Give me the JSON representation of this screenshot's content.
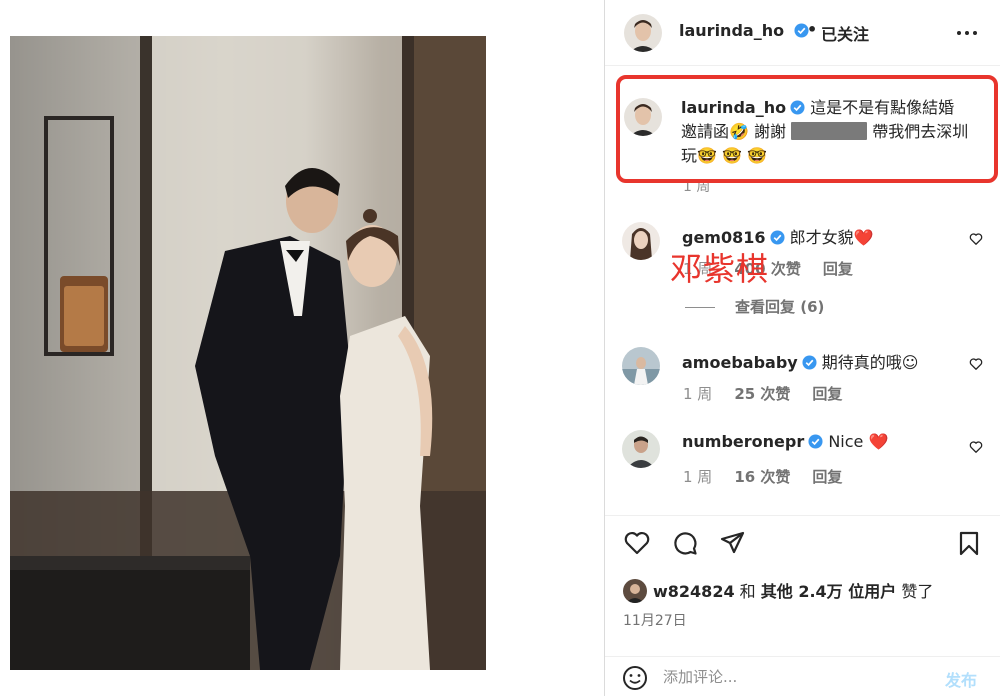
{
  "post": {
    "author": "laurinda_ho",
    "follow_status": "已关注",
    "dot": "•"
  },
  "caption": {
    "username": "laurinda_ho",
    "line1": " 這是不是有點像結婚",
    "line2": "邀請函🤣 謝謝 ",
    "line2b": " 帶我們去深圳",
    "line3": "玩🤓 🤓 🤓",
    "time": "1 周"
  },
  "comments": [
    {
      "username": "gem0816",
      "text": " 郎才女貌❤️",
      "time": "1 周",
      "likes": "400 次赞",
      "reply": "回复",
      "verified": true
    },
    {
      "username": "amoebababy",
      "text": " 期待真的哦☺",
      "time": "1 周",
      "likes": "25 次赞",
      "reply": "回复",
      "verified": true
    },
    {
      "username": "numberonepr",
      "text": " Nice ❤️",
      "time": "1 周",
      "likes": "16 次赞",
      "reply": "回复",
      "verified": true
    }
  ],
  "view_replies": "查看回复 (6)",
  "overlay_annotation": "邓紫棋",
  "likes_summary": {
    "user": "w824824",
    "and": " 和 ",
    "others": "其他 2.4万 位用户",
    "suffix": " 赞了"
  },
  "date": "11月27日",
  "composer": {
    "placeholder": "添加评论...",
    "post_label": "发布"
  },
  "icons": {
    "verified": "verified-badge-icon",
    "more": "more-options-icon",
    "like": "heart-icon",
    "comment": "comment-icon",
    "share": "share-icon",
    "save": "bookmark-icon",
    "emoji": "emoji-icon"
  },
  "colors": {
    "verified": "#3897f0",
    "annotation_red": "#e8352d",
    "post_disabled": "#b2dffc"
  }
}
